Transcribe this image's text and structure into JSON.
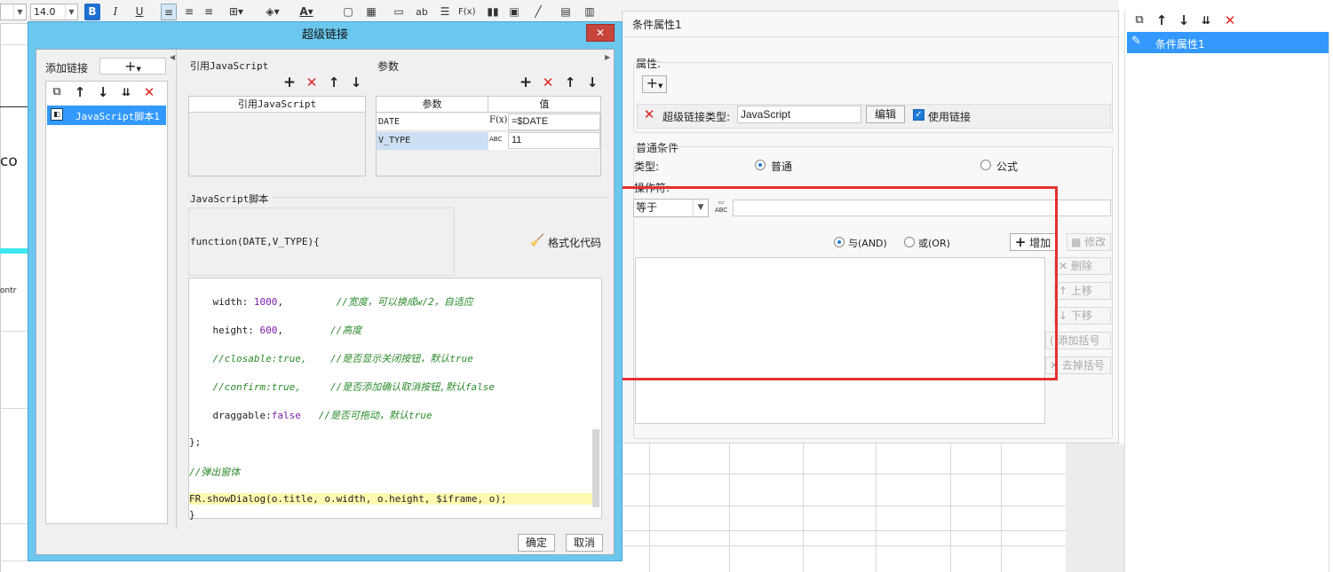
{
  "toolbar": {
    "font_size": "14.0",
    "bold": "B",
    "italic": "I",
    "underline": "U",
    "text_ab": "ab",
    "formula": "F(x)"
  },
  "background": {
    "left_text_1": "co",
    "left_text_2": "ontr"
  },
  "dialog": {
    "title": "超级链接",
    "close": "✕",
    "add_link_label": "添加链接",
    "add_link_combo": "+",
    "link_item": "JavaScript脚本1",
    "ref_js_label": "引用JavaScript",
    "ref_js_header": "引用JavaScript",
    "params_label": "参数",
    "params_headers": [
      "参数",
      "值"
    ],
    "params_rows": [
      {
        "name": "DATE",
        "type": "F(x)",
        "value": "=$DATE"
      },
      {
        "name": "V_TYPE",
        "type": "ABC",
        "value": "11"
      }
    ],
    "js_script_label": "JavaScript脚本",
    "function_sig": "function(DATE,V_TYPE){",
    "format_code": "格式化代码",
    "code_lines": [
      {
        "indent": "    ",
        "key": "width: ",
        "val": "1000",
        "rest": ",",
        "comment": "         //宽度，可以换成w/2，自适应"
      },
      {
        "indent": "    ",
        "key": "height: ",
        "val": "600",
        "rest": ",",
        "comment": "        //高度"
      },
      {
        "indent": "    ",
        "key": "",
        "val": "",
        "rest": "",
        "comment": "//closable:true,    //是否显示关闭按钮，默认true"
      },
      {
        "indent": "    ",
        "key": "",
        "val": "",
        "rest": "",
        "comment": "//confirm:true,     //是否添加确认取消按钮,默认false"
      },
      {
        "indent": "    ",
        "key": "draggable:",
        "val": "false",
        "rest": "",
        "comment": "   //是否可拖动，默认true"
      },
      {
        "indent": "",
        "key": "};",
        "val": "",
        "rest": "",
        "comment": ""
      },
      {
        "indent": "",
        "key": "",
        "val": "",
        "rest": "",
        "comment": "//弹出窗体"
      },
      {
        "indent": "",
        "key": "FR.showDialog(o.title, o.width, o.height, $iframe, o);",
        "val": "",
        "rest": "",
        "comment": ""
      },
      {
        "indent": "",
        "key": "}",
        "val": "",
        "rest": "",
        "comment": ""
      }
    ],
    "ok": "确定",
    "cancel": "取消"
  },
  "condition": {
    "title": "条件属性1",
    "attr_label": "属性:",
    "add_btn": "+",
    "link_type_label": "超级链接类型:",
    "link_type_value": "JavaScript",
    "edit_btn": "编辑",
    "use_link": "使用链接",
    "normal_cond_label": "普通条件",
    "type_label": "类型:",
    "type_normal": "普通",
    "type_formula": "公式",
    "operator_label": "操作符:",
    "operator_value": "等于",
    "and_label": "与(AND)",
    "or_label": "或(OR)",
    "add_label": "增加",
    "modify_label": "修改",
    "delete_label": "删除",
    "up_label": "上移",
    "down_label": "下移",
    "add_paren": "添加括号",
    "remove_paren": "去掉括号"
  },
  "right_panel": {
    "item": "条件属性1"
  },
  "colors": {
    "dialog_frame": "#6bc7ee",
    "selection": "#3399ff",
    "highlight": "#e53030"
  }
}
